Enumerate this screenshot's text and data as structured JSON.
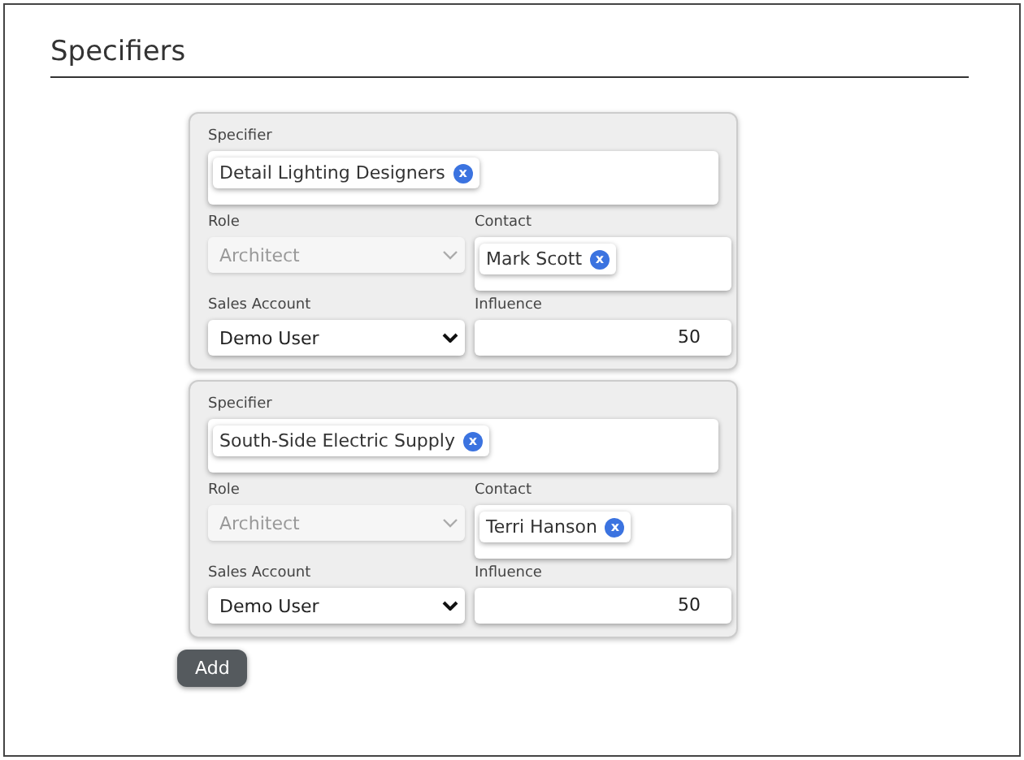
{
  "title": "Specifiers",
  "specifiers": [
    {
      "specifier_label": "Specifier",
      "specifier": {
        "name": "Detail Lighting Designers",
        "remove": "x"
      },
      "role_label": "Role",
      "role": {
        "value": "Architect",
        "disabled": true
      },
      "contact_label": "Contact",
      "contact": {
        "name": "Mark Scott",
        "remove": "x"
      },
      "sales_account_label": "Sales Account",
      "sales_account": {
        "value": "Demo User",
        "disabled": false
      },
      "influence_label": "Influence",
      "influence": "50"
    },
    {
      "specifier_label": "Specifier",
      "specifier": {
        "name": "South-Side Electric Supply",
        "remove": "x"
      },
      "role_label": "Role",
      "role": {
        "value": "Architect",
        "disabled": true
      },
      "contact_label": "Contact",
      "contact": {
        "name": "Terri Hanson",
        "remove": "x"
      },
      "sales_account_label": "Sales Account",
      "sales_account": {
        "value": "Demo User",
        "disabled": false
      },
      "influence_label": "Influence",
      "influence": "50"
    }
  ],
  "add_button": "Add"
}
